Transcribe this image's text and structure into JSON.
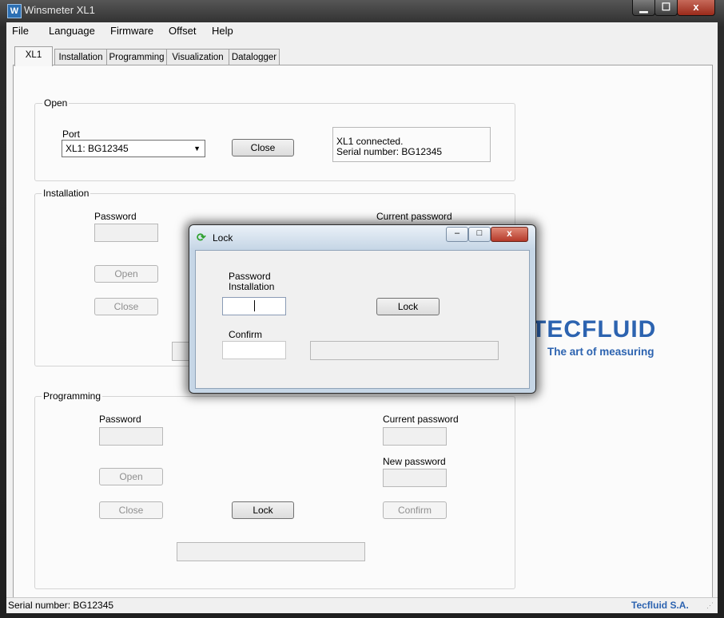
{
  "window": {
    "title": "Winsmeter XL1",
    "icon_glyph": "W"
  },
  "caption_buttons": {
    "minimize": "▁",
    "maximize": "☐",
    "close": "x"
  },
  "menu": [
    "File",
    "Language",
    "Firmware",
    "Offset",
    "Help"
  ],
  "tabs": [
    "XL1",
    "Installation",
    "Programming",
    "Visualization",
    "Datalogger"
  ],
  "open_group": {
    "title": "Open",
    "port_label": "Port",
    "port_value": "XL1:   BG12345",
    "close_label": "Close",
    "status_line1": "XL1 connected.",
    "status_line2": "Serial number: BG12345"
  },
  "installation_group": {
    "title": "Installation",
    "password_label": "Password",
    "current_password_label": "Current password",
    "open_label": "Open",
    "close_label": "Close"
  },
  "programming_group": {
    "title": "Programming",
    "password_label": "Password",
    "current_password_label": "Current password",
    "new_password_label": "New password",
    "open_label": "Open",
    "close_label": "Close",
    "lock_label": "Lock",
    "confirm_label": "Confirm"
  },
  "logo": {
    "name": "TECFLUID",
    "tagline": "The art of measuring"
  },
  "statusbar": {
    "serial": "Serial number: BG12345",
    "company": "Tecfluid S.A."
  },
  "dialog": {
    "title": "Lock",
    "password_label_line1": "Password",
    "password_label_line2": "Installation",
    "confirm_label": "Confirm",
    "lock_label": "Lock",
    "minimize": "–",
    "maximize": "□",
    "close": "x"
  },
  "colors": {
    "accent": "#2c63b0",
    "close_red": "#b53a2a"
  }
}
